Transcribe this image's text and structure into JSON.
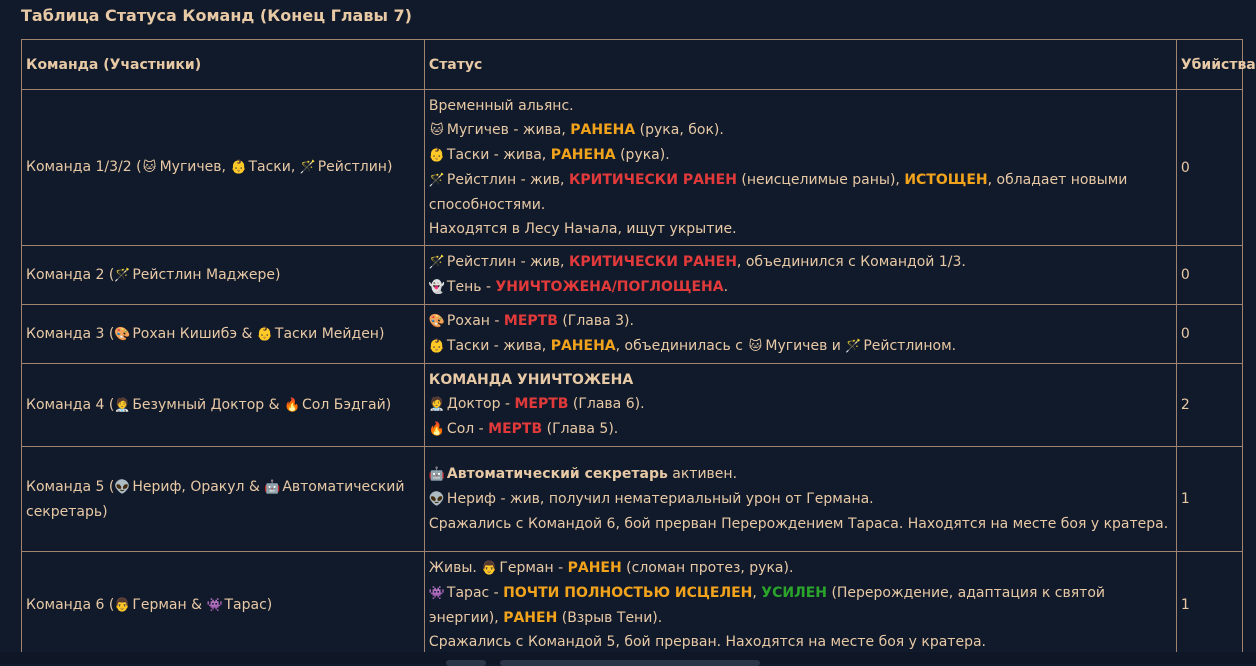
{
  "title": "Таблица Статуса Команд (Конец Главы 7)",
  "headers": {
    "team": "Команда (Участники)",
    "status": "Статус",
    "kills": "Убийства"
  },
  "colors": {
    "background": "#111a2b",
    "text": "#e8c9a5",
    "border": "#a08470",
    "red": "#e23a3a",
    "orange": "#f2a31c",
    "green": "#2aa42a"
  },
  "icons": {
    "cat": "cat-face-icon",
    "baby": "baby-face-icon",
    "wand": "magic-wand-icon",
    "ghost": "ghost-icon",
    "palette": "artist-palette-icon",
    "doctor": "doctor-icon",
    "fire": "fire-icon",
    "alien": "alien-icon",
    "robot": "robot-icon",
    "man": "man-face-icon",
    "monster": "space-invader-icon"
  },
  "rows": [
    {
      "team": {
        "pre": "Команда 1/3/2 (",
        "m1": "Мугичев,",
        "m2": "Таски,",
        "m3": "Рейстлин)"
      },
      "status": {
        "l1": "Временный альянс.",
        "l2a": "Мугичев - жива,",
        "l2b": "РАНЕНА",
        "l2c": "(рука, бок).",
        "l3a": "Таски - жива,",
        "l3b": "РАНЕНА",
        "l3c": "(рука).",
        "l4a": "Рейстлин - жив,",
        "l4b": "КРИТИЧЕСКИ РАНЕН",
        "l4c": "(неисцелимые раны),",
        "l4d": "ИСТОЩЕН",
        "l4e": ", обладает новыми способностями.",
        "l5": "Находятся в Лесу Начала, ищут укрытие."
      },
      "kills": "0"
    },
    {
      "team": {
        "pre": "Команда 2 (",
        "m1": "Рейстлин Маджере)"
      },
      "status": {
        "l1a": "Рейстлин - жив,",
        "l1b": "КРИТИЧЕСКИ РАНЕН",
        "l1c": ", объединился с Командой 1/3.",
        "l2a": "Тень -",
        "l2b": "УНИЧТОЖЕНА/ПОГЛОЩЕНА",
        "l2c": "."
      },
      "kills": "0"
    },
    {
      "team": {
        "pre": "Команда 3 (",
        "m1": "Рохан Кишибэ &",
        "m2": "Таски Мейден)"
      },
      "status": {
        "l1a": "Рохан -",
        "l1b": "МЕРТВ",
        "l1c": "(Глава 3).",
        "l2a": "Таски - жива,",
        "l2b": "РАНЕНА",
        "l2c": ", объединилась с",
        "l2d": "Мугичев и",
        "l2e": "Рейстлином."
      },
      "kills": "0"
    },
    {
      "team": {
        "pre": "Команда 4 (",
        "m1": "Безумный Доктор &",
        "m2": "Сол Бэдгай)"
      },
      "status": {
        "l1": "КОМАНДА УНИЧТОЖЕНА",
        "l2a": "Доктор -",
        "l2b": "МЕРТВ",
        "l2c": "(Глава 6).",
        "l3a": "Сол -",
        "l3b": "МЕРТВ",
        "l3c": "(Глава 5)."
      },
      "kills": "2"
    },
    {
      "team": {
        "pre": "Команда 5 (",
        "m1": "Нериф, Оракул &",
        "m2": "Автоматический секретарь)"
      },
      "status": {
        "l1a": "Автоматический секретарь",
        "l1b": "активен.",
        "l2": "Нериф - жив, получил нематериальный урон от Германа.",
        "l3": "Сражались с Командой 6, бой прерван Перерождением Тараса. Находятся на месте боя у кратера."
      },
      "kills": "1"
    },
    {
      "team": {
        "pre": "Команда 6 (",
        "m1": "Герман &",
        "m2": "Тарас)"
      },
      "status": {
        "l1a": "Живы.",
        "l1b": "Герман -",
        "l1c": "РАНЕН",
        "l1d": "(сломан протез, рука).",
        "l2a": "Тарас -",
        "l2b": "ПОЧТИ ПОЛНОСТЬЮ ИСЦЕЛЕН",
        "l2c": ",",
        "l2d": "УСИЛЕН",
        "l2e": "(Перерождение, адаптация к святой энергии),",
        "l2f": "РАНЕН",
        "l2g": "(Взрыв Тени).",
        "l3": "Сражались с Командой 5, бой прерван. Находятся на месте боя у кратера."
      },
      "kills": "1"
    }
  ]
}
